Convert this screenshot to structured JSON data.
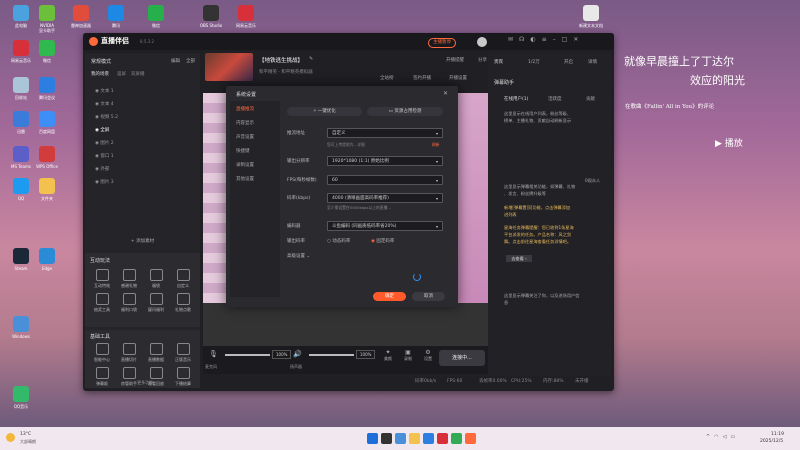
{
  "desktop_icons": [
    {
      "label": "此电脑",
      "color": "#4aa3df"
    },
    {
      "label": "NVIDIA\n显卡助手",
      "color": "#6bbf3a"
    },
    {
      "label": "网易云音乐",
      "color": "#d8303a"
    },
    {
      "label": "微信",
      "color": "#2fb94f"
    },
    {
      "label": "回收站",
      "color": "#aac4d8"
    },
    {
      "label": "腾讯会议",
      "color": "#2c7fe0"
    },
    {
      "label": "迅雷",
      "color": "#3b7bd9"
    },
    {
      "label": "百度网盘",
      "color": "#3e8ef7"
    },
    {
      "label": "MS Teams",
      "color": "#5b5fc7"
    },
    {
      "label": "WPS Office",
      "color": "#d23c3c"
    },
    {
      "label": "QQ",
      "color": "#1d9bf0"
    },
    {
      "label": "文件夹",
      "color": "#f2c14e"
    },
    {
      "label": "Steam",
      "color": "#1b2838"
    },
    {
      "label": "Edge",
      "color": "#2a8bd6"
    },
    {
      "label": "Windows",
      "color": "#4a90d9"
    },
    {
      "label": "QQ音乐",
      "color": "#33b96a"
    }
  ],
  "top_icons": [
    {
      "label": "雷神加速器",
      "color": "#e04d3c"
    },
    {
      "label": "腾讯",
      "color": "#1e88e5"
    },
    {
      "label": "微信",
      "color": "#25b04b"
    },
    {
      "label": "OBS Studio",
      "color": "#333"
    },
    {
      "label": "网易云音乐",
      "color": "#d8303a"
    },
    {
      "label": "新建文本文档",
      "color": "#e8e8e8"
    }
  ],
  "lyrics": {
    "line1": "就像早晨撞上了丁达尔",
    "line2": "效应的阳光",
    "credit": "在歌曲《Fallin' All in You》的评论",
    "play": "播放"
  },
  "app": {
    "title": "直播伴侣",
    "version": "8.5.3.2",
    "stream_title": "【地铁逃生挑战】",
    "category": "和平精英 · 和平精英模拟器",
    "live_status": "主播暂停",
    "top_actions": [
      "开播提醒",
      "分享"
    ],
    "sub_actions": [
      "全站榜",
      "签约开播",
      "开播设置"
    ],
    "scene_header": "常规模式",
    "scene_tabs": [
      "编辑",
      "全部"
    ],
    "scene_sub": [
      "我的场景",
      "竖屏",
      "双屏播"
    ],
    "scenes": [
      "文本 1",
      "文本 4",
      "视频 5.2",
      "全屏",
      "图片 2",
      "窗口 1",
      "外部",
      "图片 3"
    ],
    "add_source": "添加素材",
    "interact_title": "互动玩法",
    "interact_items": [
      "互动特效",
      "感谢礼物",
      "福袋",
      "自定义",
      "抽奖工具",
      "福利口袋",
      "疑问福利",
      "礼物点歌"
    ],
    "base_title": "基础工具",
    "base_items": [
      "智能中心",
      "直播切片",
      "直播数据",
      "正版音乐",
      "弹幕姬",
      "房管助手",
      "观看回放",
      "下播结算"
    ],
    "more_tools": "更多功能",
    "mic_label": "麦克风",
    "mic_vol": "100%",
    "speaker_label": "扬声器",
    "speaker_vol": "100%",
    "bottom_tools": [
      "美颜",
      "录制",
      "设置"
    ],
    "start_btn": "连接中...",
    "status": [
      "码率0kb/s",
      "FPS:60",
      "丢帧率0.00%",
      "CPU:25%",
      "内存:88%",
      "未开播"
    ],
    "right_tabs": [
      "贵宾",
      "1/2万",
      "开启",
      "详情"
    ],
    "right_panel_title": "弹幕助手",
    "right_sub_tabs": [
      "在线用户(1)",
      "活跃度",
      "贡献"
    ],
    "right_empty": "这里显示在线用户列表，粉丝等级、\n榜单、主播礼物、贡献自动刷新显示",
    "right_tip1": "这里显示弹幕相关功能，如弹幕、礼物\n、发言、粉丝牌升级等",
    "right_online": "0观众人",
    "right_notice1": "新增[弹幕置顶]功能，点击弹幕添加\n进列表",
    "right_notice2": "星海任务弹幕提醒：您已收到1条星海\n平台派发的任务。产品名称：风之剑\n舞。点击前往星海查看任务详情吧。",
    "right_view": "去查看 ›",
    "right_bottom": "这里显示弹幕关注了你，以及进场用户信\n息"
  },
  "dialog": {
    "title": "系统设置",
    "nav": [
      "直播推流",
      "内容显示",
      "声音设置",
      "快捷键",
      "录制设置",
      "其他设置"
    ],
    "tab_buttons": [
      "一键优化",
      "资源占用检测"
    ],
    "fields": [
      {
        "label": "推流地址",
        "value": "自定义"
      },
      {
        "label": "输出分辨率",
        "value": "1920*1080 (1:1) 原始比例"
      },
      {
        "label": "FPS(每秒帧数)",
        "value": "60"
      },
      {
        "label": "码率(kbps)",
        "value": "4000 (清晰画面高码率推荐)"
      },
      {
        "label": "编码器",
        "value": "斗鱼编码 (同画质低码率省20%)"
      }
    ],
    "hint1": "您可上传提前为...详细",
    "hint1_link": "刷新",
    "hint2": "至少需设置在5000kbps以上的直播...",
    "rate_label": "输出码率",
    "rate_options": [
      "动态码率",
      "固定码率"
    ],
    "advanced": "高级设置",
    "confirm": "确定",
    "cancel": "取消"
  },
  "taskbar": {
    "weather_temp": "13°C",
    "weather_desc": "大部晴朗",
    "time": "11:19",
    "date": "2025/12/5"
  }
}
